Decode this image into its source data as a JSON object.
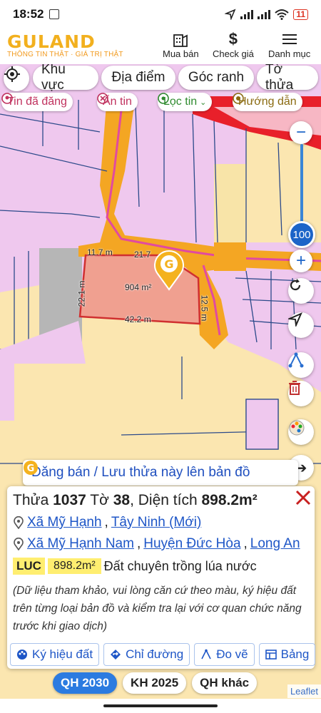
{
  "status_bar": {
    "time": "18:52",
    "battery": "11"
  },
  "header": {
    "logo": "GULAND",
    "slogan": "THÔNG TIN THẬT · GIÁ TRỊ THẬT",
    "buy_sell": "Mua bán",
    "check_price": "Check giá",
    "menu": "Danh mục"
  },
  "filters": {
    "area": "Khu vực",
    "place": "Địa điểm",
    "corner": "Góc ranh",
    "sheet_plot": "Tờ thửa",
    "posted": "Tin đã đăng",
    "hidden": "Ẩn tin",
    "filter": "Lọc tin",
    "guide": "Hướng dẫn"
  },
  "map": {
    "zoom_level": "100",
    "dims": {
      "top_left": "11.7 m",
      "top_right": "21.7",
      "left": "22.1 m",
      "right": "12.5 m",
      "bottom": "42.2 m",
      "area": "904 m²"
    },
    "post_banner": "Đăng bán / Lưu thửa này lên bản đồ",
    "attribution": "Leaflet"
  },
  "info": {
    "plot_label": "Thửa",
    "plot_no": "1037",
    "sheet_label": "Tờ",
    "sheet_no": "38",
    "area_label": "Diện tích",
    "area": "898.2m²",
    "new_addr": [
      "Xã Mỹ Hạnh",
      "Tây Ninh (Mới)"
    ],
    "old_addr": [
      "Xã Mỹ Hạnh Nam",
      "Huyện Đức Hòa",
      "Long An"
    ],
    "land_code": "LUC",
    "land_area": "898.2m²",
    "land_type": "Đất chuyên trồng lúa nước",
    "note": "(Dữ liệu tham khảo, vui lòng căn cứ theo màu, ký hiệu đất trên từng loại bản đồ và kiểm tra lại với cơ quan chức năng trước khi giao dịch)",
    "actions": [
      "Ký hiệu đất",
      "Chỉ đường",
      "Đo vẽ",
      "Bảng"
    ]
  },
  "plan_tabs": [
    "QH 2030",
    "KH 2025",
    "QH khác"
  ],
  "colors": {
    "accent": "#1e56c7",
    "plot_fill": "#f0a090",
    "road": "#f5a623",
    "land_pink": "#f0c8ee",
    "land_yellow": "#fbe7b0"
  }
}
